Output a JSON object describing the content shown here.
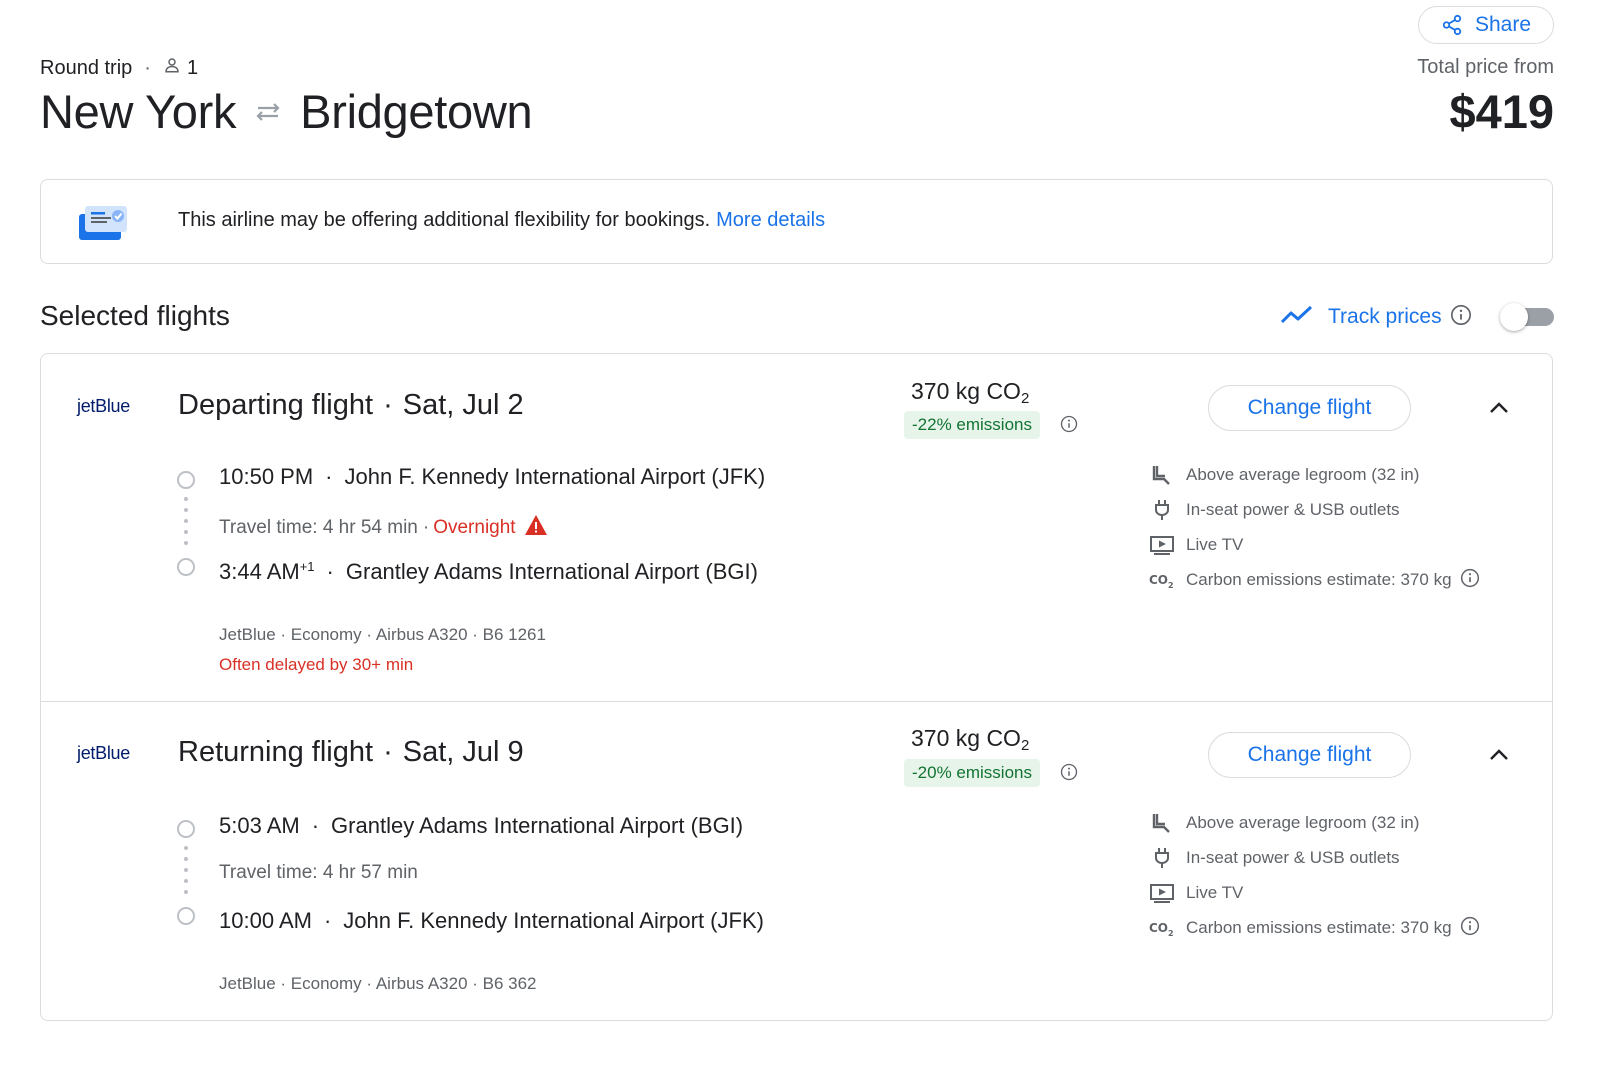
{
  "header": {
    "share_label": "Share",
    "trip_type": "Round trip",
    "passenger_count": "1",
    "origin": "New York",
    "destination": "Bridgetown",
    "price_label": "Total price from",
    "price": "$419"
  },
  "notice": {
    "text": "This airline may be offering additional flexibility for bookings.",
    "link": "More details"
  },
  "selected": {
    "title": "Selected flights",
    "track_label": "Track prices",
    "track_enabled": false
  },
  "flights": [
    {
      "airline_logo": "jetBlue",
      "label": "Departing flight",
      "date": "Sat, Jul 2",
      "co2_value": "370 kg CO",
      "co2_sub": "2",
      "emissions": "-22% emissions",
      "change_label": "Change flight",
      "dep_time": "10:50 PM",
      "dep_airport": "John F. Kennedy International Airport (JFK)",
      "travel_time": "Travel time: 4 hr 54 min",
      "overnight_label": "Overnight",
      "arr_time": "3:44 AM",
      "arr_day_offset": "+1",
      "arr_airport": "Grantley Adams International Airport (BGI)",
      "details": "JetBlue · Economy · Airbus A320 · B6 1261",
      "delay": "Often delayed by 30+ min",
      "amenities": [
        {
          "icon": "legroom-icon",
          "text": "Above average legroom (32 in)"
        },
        {
          "icon": "power-plug-icon",
          "text": "In-seat power & USB outlets"
        },
        {
          "icon": "live-tv-icon",
          "text": "Live TV"
        },
        {
          "icon": "co2-icon",
          "text": "Carbon emissions estimate: 370 kg"
        }
      ]
    },
    {
      "airline_logo": "jetBlue",
      "label": "Returning flight",
      "date": "Sat, Jul 9",
      "co2_value": "370 kg CO",
      "co2_sub": "2",
      "emissions": "-20% emissions",
      "change_label": "Change flight",
      "dep_time": "5:03 AM",
      "dep_airport": "Grantley Adams International Airport (BGI)",
      "travel_time": "Travel time: 4 hr 57 min",
      "arr_time": "10:00 AM",
      "arr_airport": "John F. Kennedy International Airport (JFK)",
      "details": "JetBlue · Economy · Airbus A320 · B6 362",
      "amenities": [
        {
          "icon": "legroom-icon",
          "text": "Above average legroom (32 in)"
        },
        {
          "icon": "power-plug-icon",
          "text": "In-seat power & USB outlets"
        },
        {
          "icon": "live-tv-icon",
          "text": "Live TV"
        },
        {
          "icon": "co2-icon",
          "text": "Carbon emissions estimate: 370 kg"
        }
      ]
    }
  ],
  "colors": {
    "accent": "#1a73e8",
    "warning": "#d93025",
    "emissions_bg": "#e6f4ea",
    "emissions_text": "#137333",
    "border": "#dadce0"
  }
}
